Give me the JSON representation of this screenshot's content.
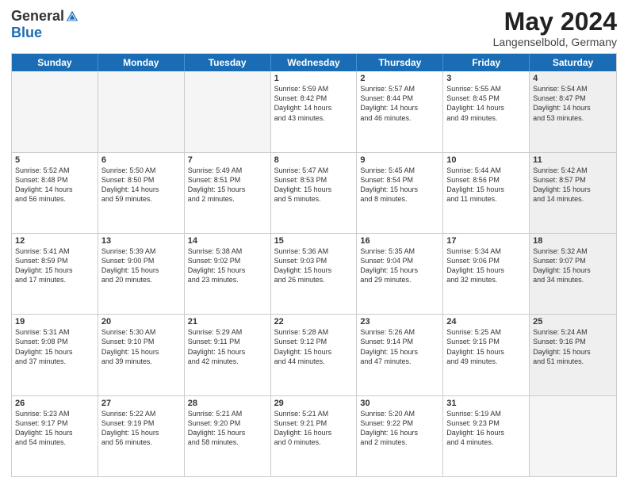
{
  "header": {
    "logo_general": "General",
    "logo_blue": "Blue",
    "month_year": "May 2024",
    "location": "Langenselbold, Germany"
  },
  "weekdays": [
    "Sunday",
    "Monday",
    "Tuesday",
    "Wednesday",
    "Thursday",
    "Friday",
    "Saturday"
  ],
  "rows": [
    [
      {
        "day": "",
        "text": "",
        "empty": true
      },
      {
        "day": "",
        "text": "",
        "empty": true
      },
      {
        "day": "",
        "text": "",
        "empty": true
      },
      {
        "day": "1",
        "text": "Sunrise: 5:59 AM\nSunset: 8:42 PM\nDaylight: 14 hours\nand 43 minutes."
      },
      {
        "day": "2",
        "text": "Sunrise: 5:57 AM\nSunset: 8:44 PM\nDaylight: 14 hours\nand 46 minutes."
      },
      {
        "day": "3",
        "text": "Sunrise: 5:55 AM\nSunset: 8:45 PM\nDaylight: 14 hours\nand 49 minutes."
      },
      {
        "day": "4",
        "text": "Sunrise: 5:54 AM\nSunset: 8:47 PM\nDaylight: 14 hours\nand 53 minutes.",
        "shaded": true
      }
    ],
    [
      {
        "day": "5",
        "text": "Sunrise: 5:52 AM\nSunset: 8:48 PM\nDaylight: 14 hours\nand 56 minutes."
      },
      {
        "day": "6",
        "text": "Sunrise: 5:50 AM\nSunset: 8:50 PM\nDaylight: 14 hours\nand 59 minutes."
      },
      {
        "day": "7",
        "text": "Sunrise: 5:49 AM\nSunset: 8:51 PM\nDaylight: 15 hours\nand 2 minutes."
      },
      {
        "day": "8",
        "text": "Sunrise: 5:47 AM\nSunset: 8:53 PM\nDaylight: 15 hours\nand 5 minutes."
      },
      {
        "day": "9",
        "text": "Sunrise: 5:45 AM\nSunset: 8:54 PM\nDaylight: 15 hours\nand 8 minutes."
      },
      {
        "day": "10",
        "text": "Sunrise: 5:44 AM\nSunset: 8:56 PM\nDaylight: 15 hours\nand 11 minutes."
      },
      {
        "day": "11",
        "text": "Sunrise: 5:42 AM\nSunset: 8:57 PM\nDaylight: 15 hours\nand 14 minutes.",
        "shaded": true
      }
    ],
    [
      {
        "day": "12",
        "text": "Sunrise: 5:41 AM\nSunset: 8:59 PM\nDaylight: 15 hours\nand 17 minutes."
      },
      {
        "day": "13",
        "text": "Sunrise: 5:39 AM\nSunset: 9:00 PM\nDaylight: 15 hours\nand 20 minutes."
      },
      {
        "day": "14",
        "text": "Sunrise: 5:38 AM\nSunset: 9:02 PM\nDaylight: 15 hours\nand 23 minutes."
      },
      {
        "day": "15",
        "text": "Sunrise: 5:36 AM\nSunset: 9:03 PM\nDaylight: 15 hours\nand 26 minutes."
      },
      {
        "day": "16",
        "text": "Sunrise: 5:35 AM\nSunset: 9:04 PM\nDaylight: 15 hours\nand 29 minutes."
      },
      {
        "day": "17",
        "text": "Sunrise: 5:34 AM\nSunset: 9:06 PM\nDaylight: 15 hours\nand 32 minutes."
      },
      {
        "day": "18",
        "text": "Sunrise: 5:32 AM\nSunset: 9:07 PM\nDaylight: 15 hours\nand 34 minutes.",
        "shaded": true
      }
    ],
    [
      {
        "day": "19",
        "text": "Sunrise: 5:31 AM\nSunset: 9:08 PM\nDaylight: 15 hours\nand 37 minutes."
      },
      {
        "day": "20",
        "text": "Sunrise: 5:30 AM\nSunset: 9:10 PM\nDaylight: 15 hours\nand 39 minutes."
      },
      {
        "day": "21",
        "text": "Sunrise: 5:29 AM\nSunset: 9:11 PM\nDaylight: 15 hours\nand 42 minutes."
      },
      {
        "day": "22",
        "text": "Sunrise: 5:28 AM\nSunset: 9:12 PM\nDaylight: 15 hours\nand 44 minutes."
      },
      {
        "day": "23",
        "text": "Sunrise: 5:26 AM\nSunset: 9:14 PM\nDaylight: 15 hours\nand 47 minutes."
      },
      {
        "day": "24",
        "text": "Sunrise: 5:25 AM\nSunset: 9:15 PM\nDaylight: 15 hours\nand 49 minutes."
      },
      {
        "day": "25",
        "text": "Sunrise: 5:24 AM\nSunset: 9:16 PM\nDaylight: 15 hours\nand 51 minutes.",
        "shaded": true
      }
    ],
    [
      {
        "day": "26",
        "text": "Sunrise: 5:23 AM\nSunset: 9:17 PM\nDaylight: 15 hours\nand 54 minutes."
      },
      {
        "day": "27",
        "text": "Sunrise: 5:22 AM\nSunset: 9:19 PM\nDaylight: 15 hours\nand 56 minutes."
      },
      {
        "day": "28",
        "text": "Sunrise: 5:21 AM\nSunset: 9:20 PM\nDaylight: 15 hours\nand 58 minutes."
      },
      {
        "day": "29",
        "text": "Sunrise: 5:21 AM\nSunset: 9:21 PM\nDaylight: 16 hours\nand 0 minutes."
      },
      {
        "day": "30",
        "text": "Sunrise: 5:20 AM\nSunset: 9:22 PM\nDaylight: 16 hours\nand 2 minutes."
      },
      {
        "day": "31",
        "text": "Sunrise: 5:19 AM\nSunset: 9:23 PM\nDaylight: 16 hours\nand 4 minutes."
      },
      {
        "day": "",
        "text": "",
        "empty": true,
        "shaded": true
      }
    ]
  ]
}
